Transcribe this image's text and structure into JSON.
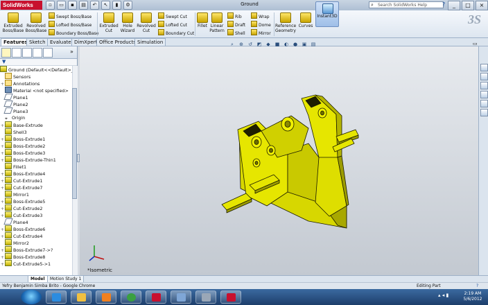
{
  "app": {
    "logo_text": "SolidWorks",
    "document_title": "Ground",
    "search_placeholder": "Search SolidWorks Help",
    "help_button": "?",
    "window_controls": [
      "_",
      "□",
      "×"
    ]
  },
  "quick_access": [
    "new-icon",
    "open-icon",
    "save-icon",
    "print-icon",
    "undo-icon",
    "select-icon",
    "rebuild-icon",
    "options-icon"
  ],
  "ribbon": {
    "large_buttons": [
      {
        "label": "Extruded\nBoss/Base",
        "icon": "extrude-boss-icon"
      },
      {
        "label": "Revolved\nBoss/Base",
        "icon": "revolve-boss-icon"
      },
      {
        "label": "Extruded\nCut",
        "icon": "extrude-cut-icon"
      },
      {
        "label": "Hole\nWizard",
        "icon": "hole-wizard-icon"
      },
      {
        "label": "Revolved\nCut",
        "icon": "revolve-cut-icon"
      },
      {
        "label": "Fillet",
        "icon": "fillet-icon"
      },
      {
        "label": "Linear\nPattern",
        "icon": "linear-pattern-icon"
      },
      {
        "label": "Reference\nGeometry",
        "icon": "reference-geometry-icon"
      },
      {
        "label": "Curves",
        "icon": "curves-icon"
      },
      {
        "label": "Instant3D",
        "icon": "instant3d-icon"
      }
    ],
    "small_buttons": [
      {
        "label": "Swept Boss/Base"
      },
      {
        "label": "Lofted Boss/Base"
      },
      {
        "label": "Boundary Boss/Base"
      },
      {
        "label": "Swept Cut"
      },
      {
        "label": "Lofted Cut"
      },
      {
        "label": "Boundary Cut"
      },
      {
        "label": "Rib"
      },
      {
        "label": "Draft"
      },
      {
        "label": "Shell"
      },
      {
        "label": "Wrap"
      },
      {
        "label": "Dome"
      },
      {
        "label": "Mirror"
      }
    ]
  },
  "command_tabs": [
    "Features",
    "Sketch",
    "Evaluate",
    "DimXpert",
    "Office Products",
    "Simulation"
  ],
  "active_tab": "Features",
  "feature_tree": {
    "root": "Ground  (Default<<Default>_D",
    "items": [
      {
        "label": "Sensors",
        "kind": "folder",
        "expand": ""
      },
      {
        "label": "Annotations",
        "kind": "folder",
        "expand": "+"
      },
      {
        "label": "Material <not specified>",
        "kind": "mat",
        "expand": ""
      },
      {
        "label": "Plane1",
        "kind": "plane",
        "expand": ""
      },
      {
        "label": "Plane2",
        "kind": "plane",
        "expand": ""
      },
      {
        "label": "Plane3",
        "kind": "plane",
        "expand": ""
      },
      {
        "label": "Origin",
        "kind": "origin",
        "expand": ""
      },
      {
        "label": "Base-Extrude",
        "kind": "feat",
        "expand": "+"
      },
      {
        "label": "Shell3",
        "kind": "feat",
        "expand": ""
      },
      {
        "label": "Boss-Extrude1",
        "kind": "feat",
        "expand": "+"
      },
      {
        "label": "Boss-Extrude2",
        "kind": "feat",
        "expand": "+"
      },
      {
        "label": "Boss-Extrude3",
        "kind": "feat",
        "expand": "+"
      },
      {
        "label": "Boss-Extrude-Thin1",
        "kind": "feat",
        "expand": "+"
      },
      {
        "label": "Fillet1",
        "kind": "feat",
        "expand": ""
      },
      {
        "label": "Boss-Extrude4",
        "kind": "feat",
        "expand": "+"
      },
      {
        "label": "Cut-Extrude1",
        "kind": "feat",
        "expand": "+"
      },
      {
        "label": "Cut-Extrude7",
        "kind": "feat",
        "expand": "+"
      },
      {
        "label": "Mirror1",
        "kind": "feat",
        "expand": ""
      },
      {
        "label": "Boss-Extrude5",
        "kind": "feat",
        "expand": "+"
      },
      {
        "label": "Cut-Extrude2",
        "kind": "feat",
        "expand": "+"
      },
      {
        "label": "Cut-Extrude3",
        "kind": "feat",
        "expand": "+"
      },
      {
        "label": "Plane4",
        "kind": "plane",
        "expand": ""
      },
      {
        "label": "Boss-Extrude6",
        "kind": "feat",
        "expand": "+"
      },
      {
        "label": "Cut-Extrude4",
        "kind": "feat",
        "expand": "+"
      },
      {
        "label": "Mirror2",
        "kind": "feat",
        "expand": ""
      },
      {
        "label": "Boss-Extrude7->?",
        "kind": "feat",
        "expand": "+"
      },
      {
        "label": "Boss-Extrude8",
        "kind": "feat",
        "expand": "+"
      },
      {
        "label": "Cut-Extrude5->1",
        "kind": "feat",
        "expand": "+"
      }
    ]
  },
  "view": {
    "orientation_label": "*Isometric"
  },
  "model_tabs": [
    "Model",
    "Motion Study 1"
  ],
  "status": {
    "left": "Yefry Benjamin Simba Brito - Google Chrome",
    "right": "Editing Part",
    "help": "?"
  },
  "taskbar": {
    "time": "2:19 AM",
    "date": "5/6/2012"
  },
  "colors": {
    "model_yellow": "#e6e600",
    "accent": "#c8102e"
  }
}
